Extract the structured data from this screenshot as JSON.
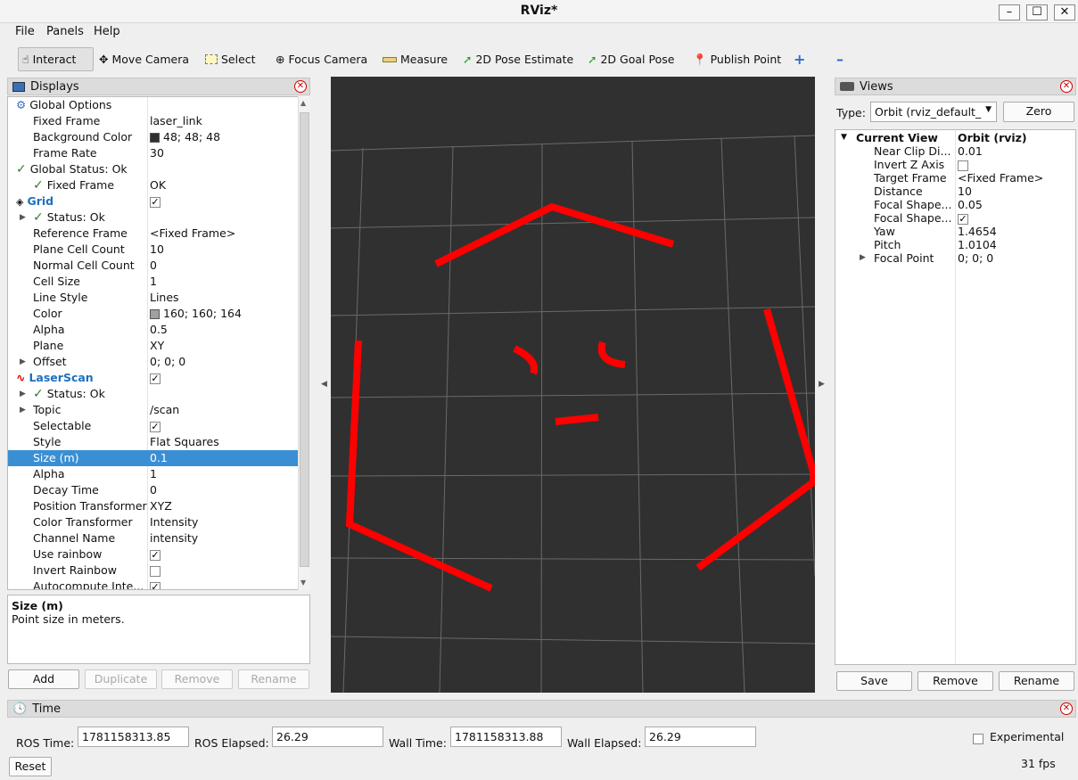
{
  "window": {
    "title": "RViz*"
  },
  "menu": {
    "file": "File",
    "panels": "Panels",
    "help": "Help"
  },
  "toolbar": {
    "interact": "Interact",
    "move_camera": "Move Camera",
    "select": "Select",
    "focus_camera": "Focus Camera",
    "measure": "Measure",
    "pose_estimate": "2D Pose Estimate",
    "goal_pose": "2D Goal Pose",
    "publish_point": "Publish Point"
  },
  "displays": {
    "title": "Displays",
    "rows": [
      {
        "label": "Global Options",
        "value": ""
      },
      {
        "label": "Fixed Frame",
        "value": "laser_link"
      },
      {
        "label": "Background Color",
        "value": "48; 48; 48"
      },
      {
        "label": "Frame Rate",
        "value": "30"
      },
      {
        "label": "Global Status: Ok",
        "value": ""
      },
      {
        "label": "Fixed Frame",
        "value": "OK"
      },
      {
        "label": "Grid",
        "value": ""
      },
      {
        "label": "Status: Ok",
        "value": ""
      },
      {
        "label": "Reference Frame",
        "value": "<Fixed Frame>"
      },
      {
        "label": "Plane Cell Count",
        "value": "10"
      },
      {
        "label": "Normal Cell Count",
        "value": "0"
      },
      {
        "label": "Cell Size",
        "value": "1"
      },
      {
        "label": "Line Style",
        "value": "Lines"
      },
      {
        "label": "Color",
        "value": "160; 160; 164"
      },
      {
        "label": "Alpha",
        "value": "0.5"
      },
      {
        "label": "Plane",
        "value": "XY"
      },
      {
        "label": "Offset",
        "value": "0; 0; 0"
      },
      {
        "label": "LaserScan",
        "value": ""
      },
      {
        "label": "Status: Ok",
        "value": ""
      },
      {
        "label": "Topic",
        "value": "/scan"
      },
      {
        "label": "Selectable",
        "value": ""
      },
      {
        "label": "Style",
        "value": "Flat Squares"
      },
      {
        "label": "Size (m)",
        "value": "0.1"
      },
      {
        "label": "Alpha",
        "value": "1"
      },
      {
        "label": "Decay Time",
        "value": "0"
      },
      {
        "label": "Position Transformer",
        "value": "XYZ"
      },
      {
        "label": "Color Transformer",
        "value": "Intensity"
      },
      {
        "label": "Channel Name",
        "value": "intensity"
      },
      {
        "label": "Use rainbow",
        "value": ""
      },
      {
        "label": "Invert Rainbow",
        "value": ""
      },
      {
        "label": "Autocompute Inte...",
        "value": ""
      }
    ],
    "description": {
      "title": "Size (m)",
      "text": "Point size in meters."
    },
    "buttons": {
      "add": "Add",
      "duplicate": "Duplicate",
      "remove": "Remove",
      "rename": "Rename"
    }
  },
  "views": {
    "title": "Views",
    "type_label": "Type:",
    "type_value": "Orbit (rviz_default_",
    "zero": "Zero",
    "header": {
      "name": "Current View",
      "value": "Orbit (rviz)"
    },
    "rows": [
      {
        "label": "Near Clip Di...",
        "value": "0.01"
      },
      {
        "label": "Invert Z Axis",
        "value": ""
      },
      {
        "label": "Target Frame",
        "value": "<Fixed Frame>"
      },
      {
        "label": "Distance",
        "value": "10"
      },
      {
        "label": "Focal Shape...",
        "value": "0.05"
      },
      {
        "label": "Focal Shape...",
        "value": ""
      },
      {
        "label": "Yaw",
        "value": "1.4654"
      },
      {
        "label": "Pitch",
        "value": "1.0104"
      },
      {
        "label": "Focal Point",
        "value": "0; 0; 0"
      }
    ],
    "buttons": {
      "save": "Save",
      "remove": "Remove",
      "rename": "Rename"
    }
  },
  "time": {
    "title": "Time",
    "ros_time_label": "ROS Time:",
    "ros_time": "1781158313.85",
    "ros_elapsed_label": "ROS Elapsed:",
    "ros_elapsed": "26.29",
    "wall_time_label": "Wall Time:",
    "wall_time": "1781158313.88",
    "wall_elapsed_label": "Wall Elapsed:",
    "wall_elapsed": "26.29",
    "experimental": "Experimental",
    "reset": "Reset",
    "fps": "31 fps"
  }
}
